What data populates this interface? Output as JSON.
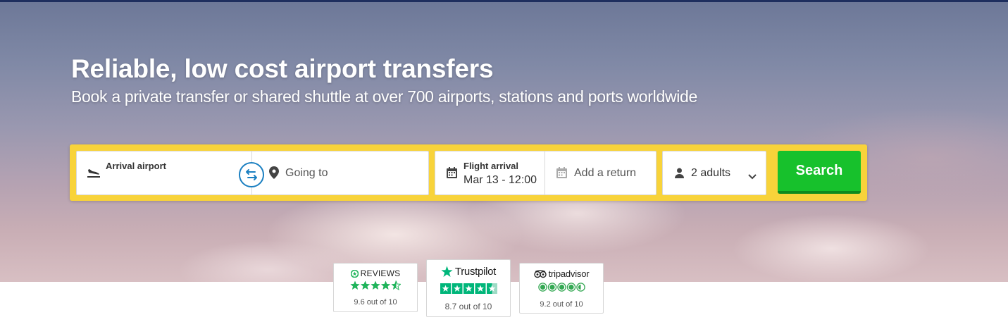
{
  "hero": {
    "title": "Reliable, low cost airport transfers",
    "subtitle": "Book a private transfer or shared shuttle at over 700 airports, stations and ports worldwide"
  },
  "search": {
    "from_label": "Arrival airport",
    "to_placeholder": "Going to",
    "date_label": "Flight arrival",
    "date_value": "Mar 13 - 12:00",
    "return_placeholder": "Add a return",
    "passengers_value": "2 adults",
    "search_label": "Search"
  },
  "reviews": [
    {
      "brand": "REVIEWS",
      "score_text": "9.6 out of 10",
      "stars": 4.5
    },
    {
      "brand": "Trustpilot",
      "score_text": "8.7 out of 10",
      "stars": 4.5
    },
    {
      "brand": "tripadvisor",
      "score_text": "9.2 out of 10",
      "stars": 4.5
    }
  ],
  "colors": {
    "accent_yellow": "#f8d33a",
    "search_green": "#17c12c",
    "swap_blue": "#1a7fc1",
    "reviews_green": "#1fb45a",
    "trustpilot_green": "#00b67a",
    "tripadvisor_green": "#34a853"
  }
}
